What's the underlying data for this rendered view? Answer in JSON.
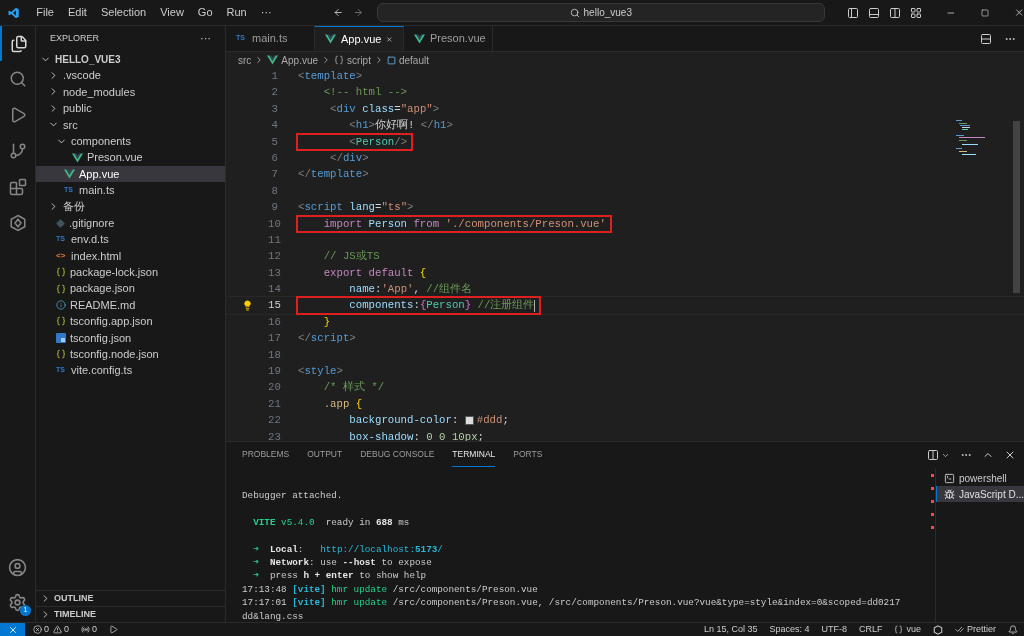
{
  "title_bar": {
    "menu": [
      "File",
      "Edit",
      "Selection",
      "View",
      "Go",
      "Run",
      "···"
    ],
    "search": "hello_vue3"
  },
  "activity_bar": {
    "settings_badge": "1"
  },
  "sidebar": {
    "title": "EXPLORER",
    "more": "···",
    "tree": [
      {
        "label": "HELLO_VUE3",
        "kind": "root",
        "expanded": true,
        "selected": false,
        "children": [
          {
            "label": ".vscode",
            "kind": "folder",
            "expanded": false,
            "selected": false
          },
          {
            "label": "node_modules",
            "kind": "folder",
            "expanded": false,
            "selected": false
          },
          {
            "label": "public",
            "kind": "folder",
            "expanded": false,
            "selected": false
          },
          {
            "label": "src",
            "kind": "folder",
            "expanded": true,
            "selected": false,
            "children": [
              {
                "label": "components",
                "kind": "folder",
                "expanded": true,
                "selected": false,
                "children": [
                  {
                    "label": "Preson.vue",
                    "kind": "vue",
                    "selected": false
                  }
                ]
              },
              {
                "label": "App.vue",
                "kind": "vue",
                "selected": true
              },
              {
                "label": "main.ts",
                "kind": "ts",
                "icon": "TS",
                "selected": false
              }
            ]
          },
          {
            "label": "备份",
            "kind": "folder",
            "expanded": false,
            "selected": false
          },
          {
            "label": ".gitignore",
            "kind": "git",
            "selected": false
          },
          {
            "label": "env.d.ts",
            "kind": "ts",
            "icon": "TS",
            "selected": false
          },
          {
            "label": "index.html",
            "kind": "html",
            "icon": "<>",
            "selected": false
          },
          {
            "label": "package-lock.json",
            "kind": "json",
            "selected": false
          },
          {
            "label": "package.json",
            "kind": "json",
            "selected": false
          },
          {
            "label": "README.md",
            "kind": "info",
            "selected": false
          },
          {
            "label": "tsconfig.app.json",
            "kind": "json",
            "selected": false
          },
          {
            "label": "tsconfig.json",
            "kind": "tsconfig",
            "selected": false
          },
          {
            "label": "tsconfig.node.json",
            "kind": "json",
            "selected": false
          },
          {
            "label": "vite.config.ts",
            "kind": "ts",
            "icon": "TS",
            "selected": false
          }
        ]
      }
    ],
    "sections": [
      {
        "label": "OUTLINE",
        "expanded": false
      },
      {
        "label": "TIMELINE",
        "expanded": false
      }
    ]
  },
  "tabs": [
    {
      "label": "main.ts",
      "kind": "ts",
      "icon": "TS",
      "selected": false
    },
    {
      "label": "App.vue",
      "kind": "vue",
      "selected": true
    },
    {
      "label": "Preson.vue",
      "kind": "vue",
      "selected": false
    }
  ],
  "breadcrumb": [
    {
      "label": "src",
      "kind": "folder"
    },
    {
      "label": "App.vue",
      "kind": "vue"
    },
    {
      "label": "script",
      "kind": "braces"
    },
    {
      "label": "default",
      "kind": "symbol"
    }
  ],
  "code": [
    {
      "n": "1",
      "current": false,
      "boxed": false,
      "tokens": [
        {
          "text": "<",
          "kind": "punct"
        },
        {
          "text": "template",
          "kind": "tag"
        },
        {
          "text": ">",
          "kind": "punct"
        }
      ]
    },
    {
      "n": "2",
      "current": false,
      "boxed": false,
      "tokens": [
        {
          "text": "    <!-- html -->",
          "kind": "comment"
        }
      ]
    },
    {
      "n": "3",
      "current": false,
      "boxed": false,
      "tokens": [
        {
          "text": "     <",
          "kind": "punct"
        },
        {
          "text": "div",
          "kind": "tag"
        },
        {
          "text": " class",
          "kind": "attr"
        },
        {
          "text": "=",
          "kind": "plain"
        },
        {
          "text": "\"app\"",
          "kind": "string"
        },
        {
          "text": ">",
          "kind": "punct"
        }
      ]
    },
    {
      "n": "4",
      "current": false,
      "boxed": false,
      "tokens": [
        {
          "text": "        <",
          "kind": "punct"
        },
        {
          "text": "h1",
          "kind": "tag"
        },
        {
          "text": ">",
          "kind": "punct"
        },
        {
          "text": "你好啊! ",
          "kind": "plain"
        },
        {
          "text": "</",
          "kind": "punct"
        },
        {
          "text": "h1",
          "kind": "tag"
        },
        {
          "text": ">",
          "kind": "punct"
        }
      ]
    },
    {
      "n": "5",
      "current": false,
      "boxed": true,
      "tokens": [
        {
          "text": "        <",
          "kind": "punct"
        },
        {
          "text": "Person",
          "kind": "component"
        },
        {
          "text": "/>",
          "kind": "punct"
        }
      ]
    },
    {
      "n": "6",
      "current": false,
      "boxed": false,
      "tokens": [
        {
          "text": "     </",
          "kind": "punct"
        },
        {
          "text": "div",
          "kind": "tag"
        },
        {
          "text": ">",
          "kind": "punct"
        }
      ]
    },
    {
      "n": "7",
      "current": false,
      "boxed": false,
      "tokens": [
        {
          "text": "</",
          "kind": "punct"
        },
        {
          "text": "template",
          "kind": "tag"
        },
        {
          "text": ">",
          "kind": "punct"
        }
      ]
    },
    {
      "n": "8",
      "current": false,
      "boxed": false
    },
    {
      "n": "9",
      "current": false,
      "boxed": false,
      "tokens": [
        {
          "text": "<",
          "kind": "punct"
        },
        {
          "text": "script",
          "kind": "tag"
        },
        {
          "text": " lang",
          "kind": "attr"
        },
        {
          "text": "=",
          "kind": "plain"
        },
        {
          "text": "\"ts\"",
          "kind": "string"
        },
        {
          "text": ">",
          "kind": "punct"
        }
      ]
    },
    {
      "n": "10",
      "current": false,
      "boxed": true,
      "tokens": [
        {
          "text": "    import",
          "kind": "keyword"
        },
        {
          "text": " Person ",
          "kind": "variable"
        },
        {
          "text": "from",
          "kind": "keyword"
        },
        {
          "text": " './components/Preson.vue'",
          "kind": "string"
        }
      ]
    },
    {
      "n": "11",
      "current": false,
      "boxed": false
    },
    {
      "n": "12",
      "current": false,
      "boxed": false,
      "tokens": [
        {
          "text": "    // JS或TS",
          "kind": "comment"
        }
      ]
    },
    {
      "n": "13",
      "current": false,
      "boxed": false,
      "tokens": [
        {
          "text": "    export default ",
          "kind": "keyword"
        },
        {
          "text": "{",
          "kind": "brace"
        }
      ]
    },
    {
      "n": "14",
      "current": false,
      "boxed": false,
      "tokens": [
        {
          "text": "        name",
          "kind": "variable"
        },
        {
          "text": ":",
          "kind": "plain"
        },
        {
          "text": "'App'",
          "kind": "string"
        },
        {
          "text": ", ",
          "kind": "plain"
        },
        {
          "text": "//组件名",
          "kind": "comment"
        }
      ]
    },
    {
      "n": "15",
      "current": true,
      "boxed": true,
      "tokens": [
        {
          "text": "        components",
          "kind": "variable"
        },
        {
          "text": ":",
          "kind": "plain"
        },
        {
          "text": "{",
          "kind": "brace2"
        },
        {
          "text": "Person",
          "kind": "component"
        },
        {
          "text": "}",
          "kind": "brace2"
        },
        {
          "text": " //注册组件",
          "kind": "comment"
        }
      ]
    },
    {
      "n": "16",
      "current": false,
      "boxed": false,
      "tokens": [
        {
          "text": "    }",
          "kind": "brace"
        }
      ]
    },
    {
      "n": "17",
      "current": false,
      "boxed": false,
      "tokens": [
        {
          "text": "</",
          "kind": "punct"
        },
        {
          "text": "script",
          "kind": "tag"
        },
        {
          "text": ">",
          "kind": "punct"
        }
      ]
    },
    {
      "n": "18",
      "current": false,
      "boxed": false
    },
    {
      "n": "19",
      "current": false,
      "boxed": false,
      "tokens": [
        {
          "text": "<",
          "kind": "punct"
        },
        {
          "text": "style",
          "kind": "tag"
        },
        {
          "text": ">",
          "kind": "punct"
        }
      ]
    },
    {
      "n": "20",
      "current": false,
      "boxed": false,
      "tokens": [
        {
          "text": "    /* 样式 */",
          "kind": "comment"
        }
      ]
    },
    {
      "n": "21",
      "current": false,
      "boxed": false,
      "tokens": [
        {
          "text": "    .app ",
          "kind": "selector"
        },
        {
          "text": "{",
          "kind": "brace"
        }
      ]
    },
    {
      "n": "22",
      "current": false,
      "boxed": false,
      "tokens": [
        {
          "text": "        background-color",
          "kind": "variable"
        },
        {
          "text": ": ",
          "kind": "plain"
        },
        {
          "text": "#ddd",
          "kind": "color",
          "color": "#dddddd"
        },
        {
          "text": ";",
          "kind": "plain"
        }
      ]
    },
    {
      "n": "23",
      "current": false,
      "boxed": false,
      "tokens": [
        {
          "text": "        box-shadow",
          "kind": "variable"
        },
        {
          "text": ": ",
          "kind": "plain"
        },
        {
          "text": "0 0 10px",
          "kind": "number"
        },
        {
          "text": ";",
          "kind": "plain"
        }
      ]
    }
  ],
  "panel": {
    "tabs": [
      {
        "label": "PROBLEMS",
        "selected": false
      },
      {
        "label": "OUTPUT",
        "selected": false
      },
      {
        "label": "DEBUG CONSOLE",
        "selected": false
      },
      {
        "label": "TERMINAL",
        "selected": true
      },
      {
        "label": "PORTS",
        "selected": false
      }
    ],
    "terminal_blocks": [
      [
        [
          {
            "text": "Debugger attached.",
            "kind": "plain"
          }
        ]
      ],
      [
        [
          {
            "text": "  VITE",
            "kind": "greenbold"
          },
          {
            "text": " v5.4.0",
            "kind": "green"
          },
          {
            "text": "  ready in ",
            "kind": "plain"
          },
          {
            "text": "688",
            "kind": "bold"
          },
          {
            "text": " ms",
            "kind": "plain"
          }
        ]
      ],
      [
        [
          {
            "text": "  ➜",
            "kind": "green"
          },
          {
            "text": "  Local",
            "kind": "bold"
          },
          {
            "text": ":   ",
            "kind": "plain"
          },
          {
            "text": "http://localhost:",
            "kind": "cyan"
          },
          {
            "text": "5173",
            "kind": "cyanbold"
          },
          {
            "text": "/",
            "kind": "cyan"
          }
        ],
        [
          {
            "text": "  ➜",
            "kind": "green"
          },
          {
            "text": "  Network",
            "kind": "bold"
          },
          {
            "text": ": use ",
            "kind": "plain"
          },
          {
            "text": "--host",
            "kind": "bold"
          },
          {
            "text": " to expose",
            "kind": "plain"
          }
        ],
        [
          {
            "text": "  ➜",
            "kind": "green"
          },
          {
            "text": "  press ",
            "kind": "plain"
          },
          {
            "text": "h + enter",
            "kind": "bold"
          },
          {
            "text": " to show help",
            "kind": "plain"
          }
        ],
        [
          {
            "text": "17:13:48 ",
            "kind": "plain"
          },
          {
            "text": "[vite]",
            "kind": "cyanbold"
          },
          {
            "text": " hmr update",
            "kind": "green"
          },
          {
            "text": " /src/components/Preson.vue",
            "kind": "plain"
          }
        ],
        [
          {
            "text": "17:17:01 ",
            "kind": "plain"
          },
          {
            "text": "[vite]",
            "kind": "cyanbold"
          },
          {
            "text": " hmr update",
            "kind": "green"
          },
          {
            "text": " /src/components/Preson.vue, /src/components/Preson.vue?vue&type=style&index=0&scoped=dd0217",
            "kind": "plain"
          }
        ],
        [
          {
            "text": "dd&lang.css",
            "kind": "plain"
          }
        ]
      ]
    ],
    "terminals": [
      {
        "label": "powershell",
        "kind": "shell",
        "selected": false
      },
      {
        "label": "JavaScript D...",
        "kind": "debug",
        "selected": true
      }
    ]
  },
  "status_bar": {
    "errors": "0",
    "warnings": "0",
    "ports": "0",
    "right": [
      {
        "kind": "text",
        "label": "Ln 15, Col 35"
      },
      {
        "kind": "text",
        "label": "Spaces: 4"
      },
      {
        "kind": "text",
        "label": "UTF-8"
      },
      {
        "kind": "text",
        "label": "CRLF"
      },
      {
        "kind": "language",
        "label": "vue"
      },
      {
        "kind": "prettier",
        "label": "Prettier"
      }
    ]
  }
}
